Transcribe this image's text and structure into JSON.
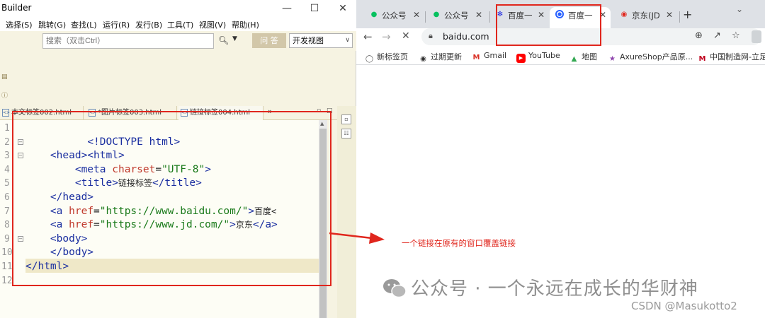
{
  "hbuilder": {
    "title": "Builder",
    "menu": [
      "选择(S)",
      "跳转(G)",
      "查找(L)",
      "运行(R)",
      "发行(B)",
      "工具(T)",
      "视图(V)",
      "帮助(H)"
    ],
    "search_placeholder": "搜索（双击Ctrl）",
    "qa_label": "问 答",
    "view_select": "开发视图",
    "file_tabs": [
      "本文标签002.html",
      "*图片标签003.html",
      "链接标签004.html"
    ],
    "more_tabs": "»",
    "line_numbers": [
      "1",
      "2",
      "3",
      "4",
      "5",
      "6",
      "7",
      "8",
      "9",
      "10",
      "11",
      "12"
    ],
    "code": {
      "l1": "<!DOCTYPE html>",
      "l2": "<html>",
      "l3": "<head>",
      "l4_tag": "<meta",
      "l4_attr": "charset",
      "l4_eq": "=",
      "l4_str": "\"UTF-8\"",
      "l4_end": ">",
      "l5_tag": "<title>",
      "l5_txt": "链接标签",
      "l5_end": "</title>",
      "l6": "</head>",
      "l7_tag": "<a",
      "l7_attr": "href",
      "l7_eq": "=",
      "l7_str": "\"https://www.baidu.com/\"",
      "l7_end": ">",
      "l7_txt": "百度<",
      "l8_tag": "<a",
      "l8_attr": "href",
      "l8_eq": "=",
      "l8_str": "\"https://www.jd.com/\"",
      "l8_end": ">",
      "l8_txt": "京东",
      "l8_close": "</a>",
      "l9": "<body>",
      "l10": "</body>",
      "l11": "</html>"
    }
  },
  "chrome": {
    "tabs": [
      {
        "label": "公众号",
        "icon": "wechat-icon"
      },
      {
        "label": "公众号",
        "icon": "wechat-icon"
      },
      {
        "label": "百度一",
        "icon": "baidu-icon"
      },
      {
        "label": "百度一",
        "icon": "loading-icon"
      },
      {
        "label": "京东(JD",
        "icon": "jd-icon"
      }
    ],
    "new_tab": "+",
    "url": "baidu.com",
    "bookmarks": [
      "新标签页",
      "过期更新",
      "Gmail",
      "YouTube",
      "地图",
      "AxureShop产品原...",
      "中国制造网-立足..."
    ]
  },
  "annotation": "一个链接在原有的窗口覆盖链接",
  "watermark": "公众号 · 一个永远在成长的华财神",
  "credit": "CSDN @Masukotto2",
  "colors": {
    "annotation_red": "#e0261d",
    "hbuilder_bg": "#f6f3e2",
    "tag_blue": "#1b2fa0",
    "attr_red": "#c0392b",
    "string_green": "#1a7a1a"
  }
}
